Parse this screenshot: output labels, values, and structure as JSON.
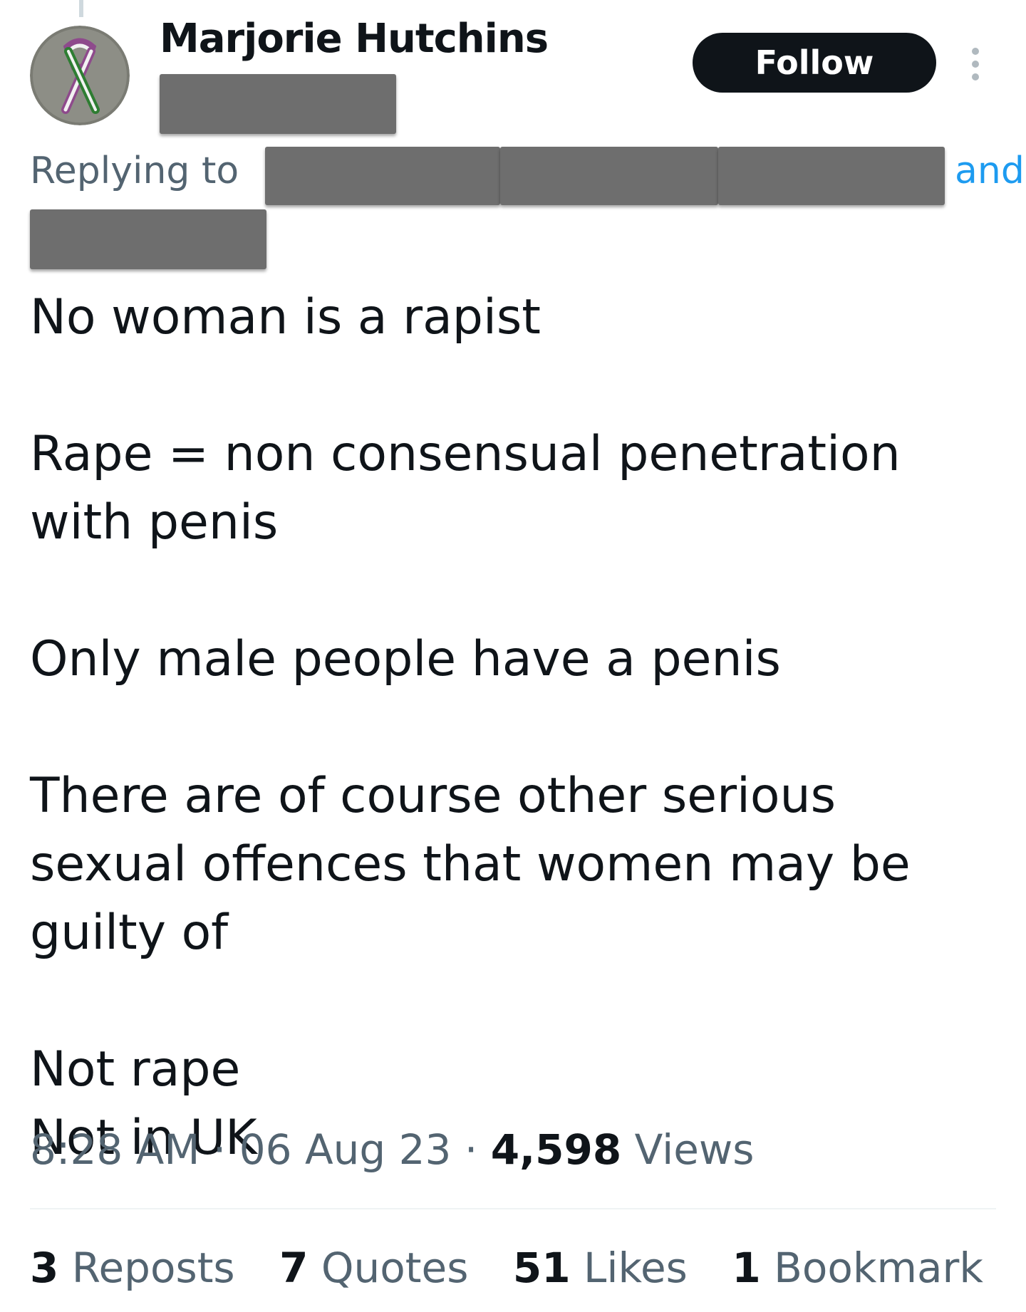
{
  "author": {
    "display_name": "Marjorie Hutchins",
    "handle": "",
    "avatar_icon": "purple-white-green-ribbon-avatar"
  },
  "follow_label": "Follow",
  "more_icon": "more-vertical-icon",
  "reply_context": {
    "prefix": "Replying to",
    "and_label": "and"
  },
  "tweet": {
    "paragraphs": [
      [
        "No woman is a rapist"
      ],
      [
        "Rape = non consensual penetration with penis"
      ],
      [
        "Only male people have a penis"
      ],
      [
        "There are of course other serious sexual offences that women may be guilty of"
      ],
      [
        "Not rape",
        "Not in UK"
      ]
    ]
  },
  "meta": {
    "time": "8:28 AM",
    "date": "06 Aug 23",
    "views_count": "4,598",
    "views_label": "Views",
    "separator": "·"
  },
  "stats": [
    {
      "count": "3",
      "label": "Reposts"
    },
    {
      "count": "7",
      "label": "Quotes"
    },
    {
      "count": "51",
      "label": "Likes"
    },
    {
      "count": "1",
      "label": "Bookmark"
    }
  ],
  "colors": {
    "text_primary": "#0f1419",
    "text_secondary": "#536471",
    "link": "#1d9bf0",
    "follow_bg": "#0f1419",
    "redaction": "#6e6e6e",
    "ribbon_purple": "#8e4a8c",
    "ribbon_green": "#2e7d32"
  }
}
